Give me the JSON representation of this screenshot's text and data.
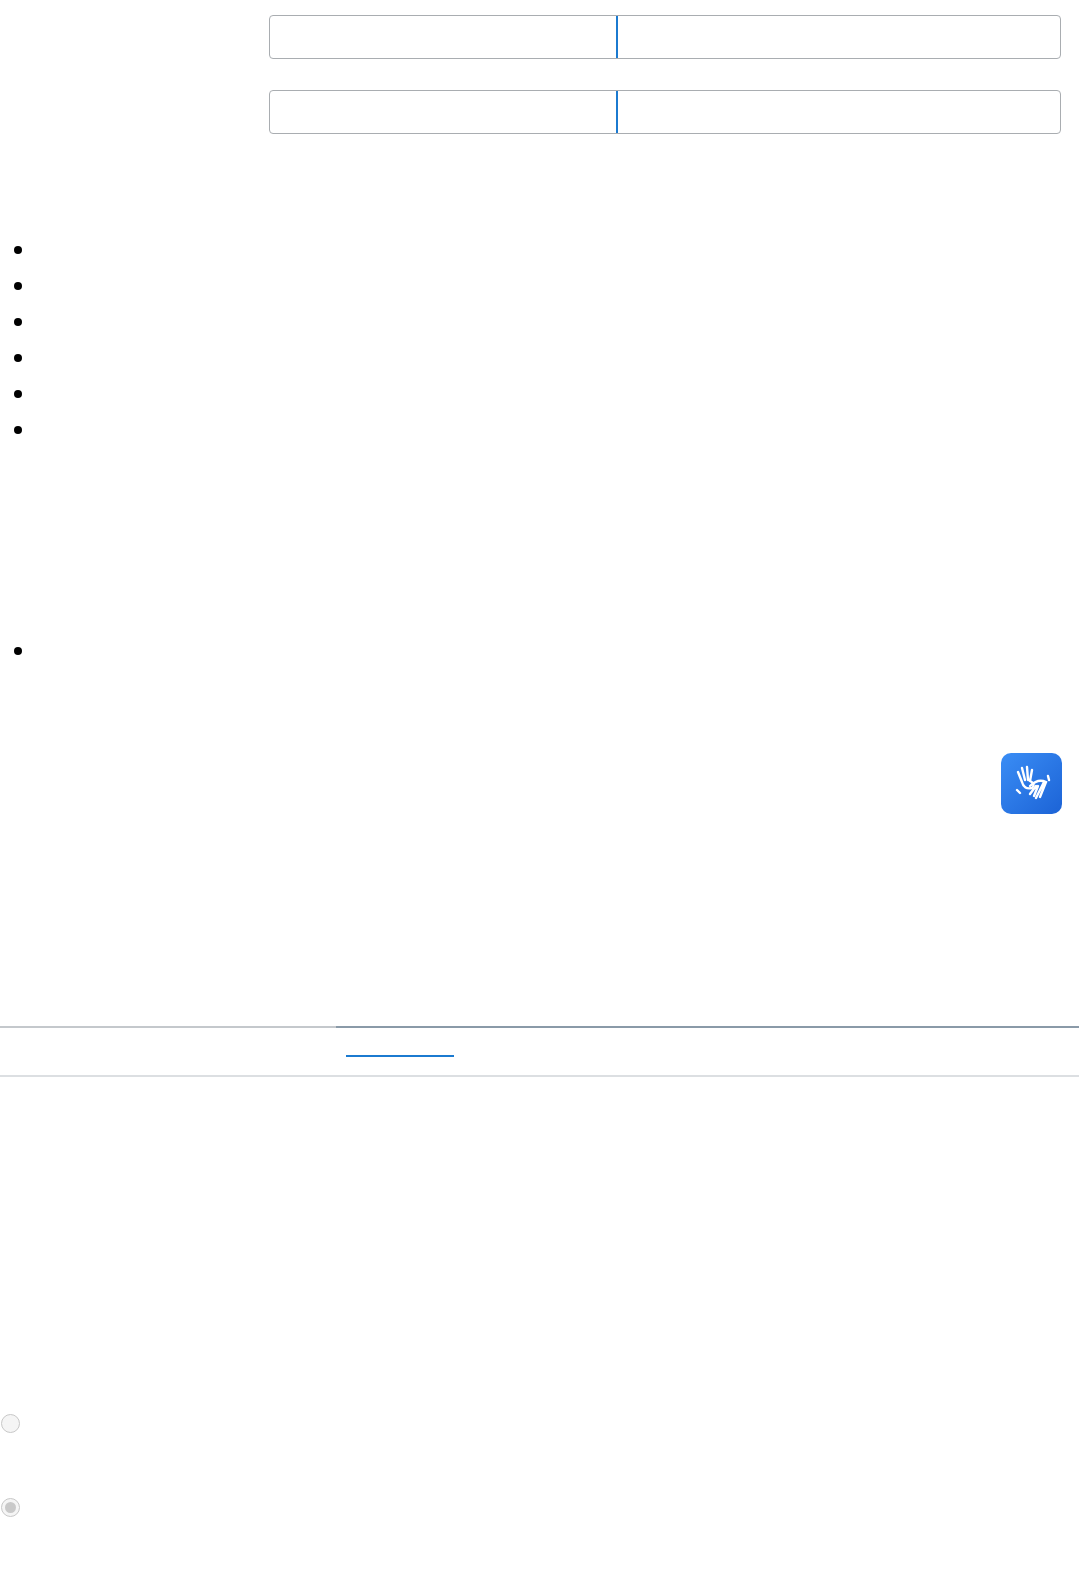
{
  "fields": [
    {
      "kind": "split"
    },
    {
      "kind": "split"
    }
  ],
  "list_1": [
    {
      "kind": "bullet"
    },
    {
      "kind": "bullet"
    },
    {
      "kind": "bullet"
    },
    {
      "kind": "bullet"
    },
    {
      "kind": "bullet"
    },
    {
      "kind": "bullet"
    }
  ],
  "list_2": [
    {
      "kind": "bullet"
    }
  ],
  "accessibility_button": {
    "kind": "sign-language"
  },
  "tabs": [
    {
      "selected": false
    },
    {
      "selected": true
    }
  ],
  "link": {
    "kind": "underline"
  },
  "radios": [
    {
      "selected": false,
      "disabled": true
    },
    {
      "selected": true,
      "disabled": true
    }
  ]
}
